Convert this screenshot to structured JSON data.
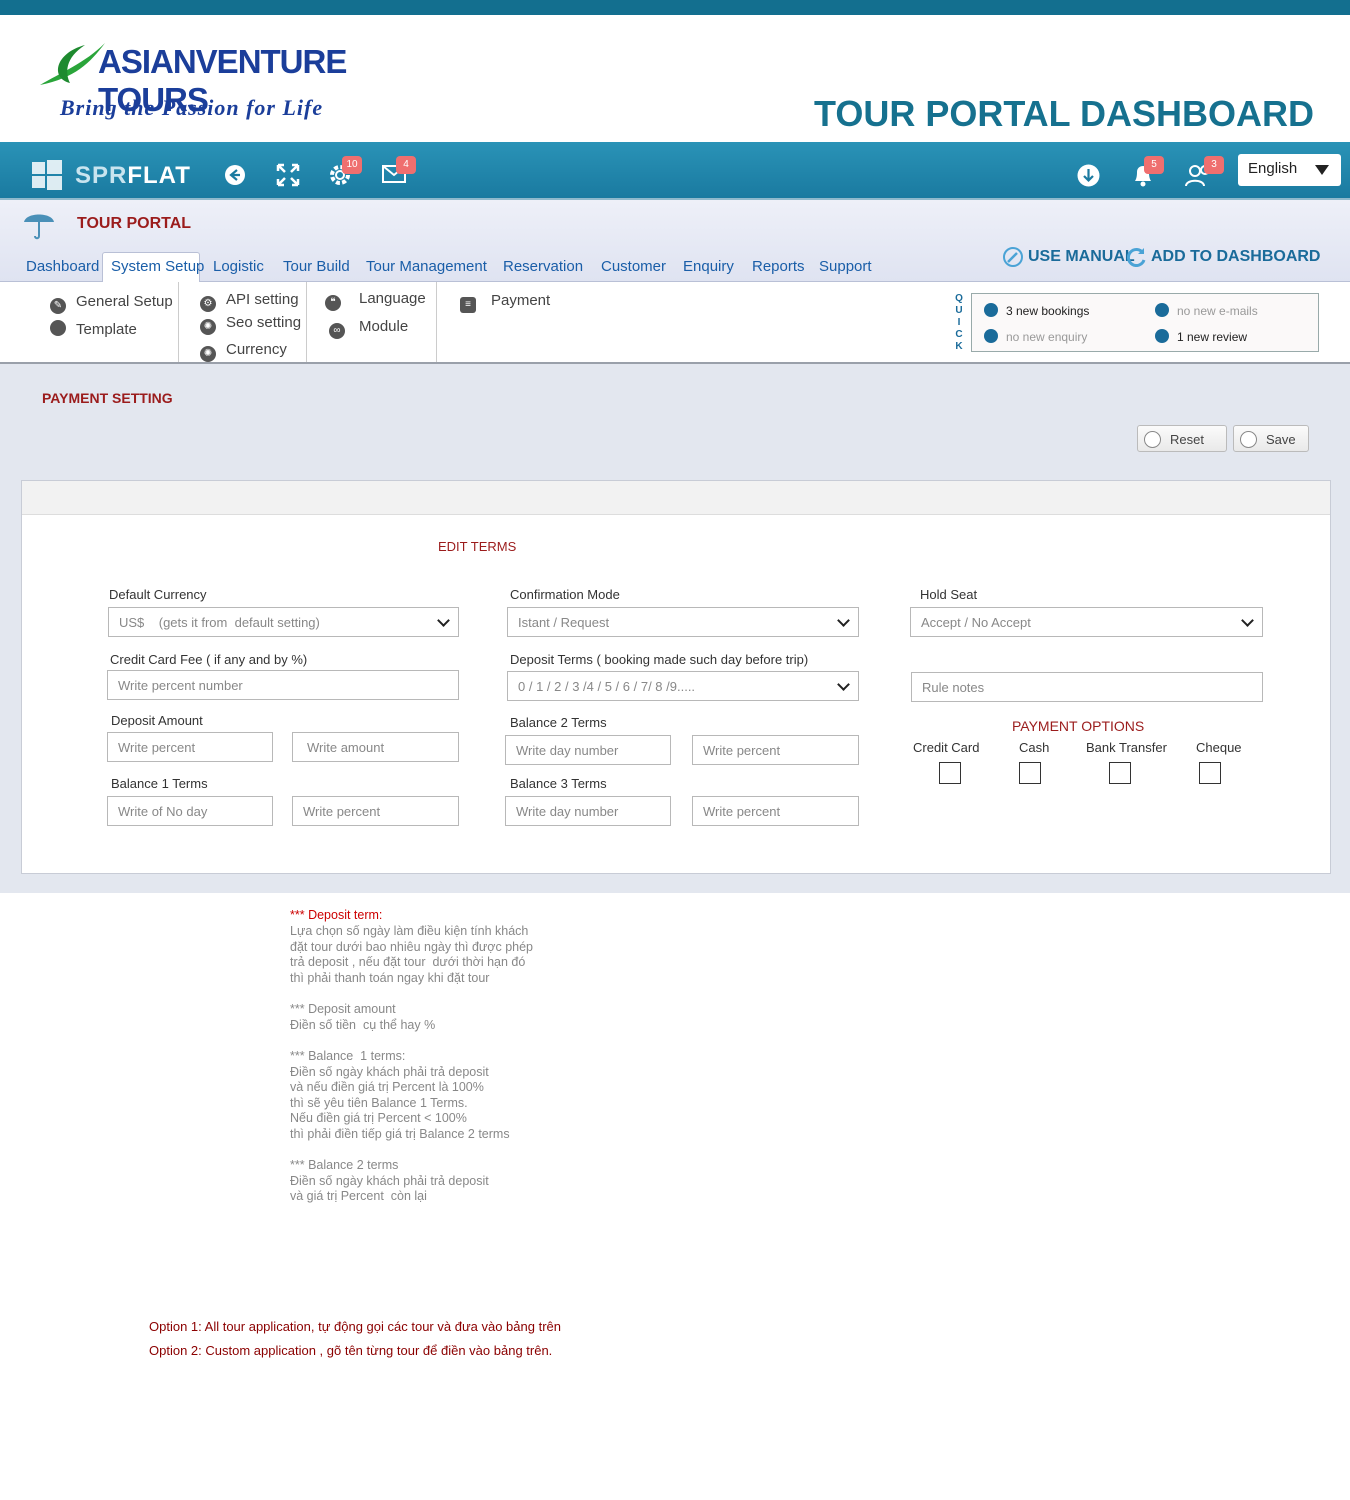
{
  "header": {
    "logo_text": "ASIANVENTURE TOURS",
    "tagline": "Bring the Passion for Life",
    "dashboard_title": "TOUR PORTAL DASHBOARD"
  },
  "navbar": {
    "brand_dim": "SPR",
    "brand_bright": "FLAT",
    "settings_badge": "10",
    "mail_badge": "4",
    "notif_badge": "5",
    "users_badge": "3",
    "language": "English"
  },
  "portal": {
    "title": "TOUR PORTAL",
    "tabs": [
      "Dashboard",
      "System Setup",
      "Logistic",
      "Tour Build",
      "Tour Management",
      "Reservation",
      "Customer",
      "Enquiry",
      "Reports",
      "Support"
    ],
    "use_manual": "USE MANUAL",
    "add_dashboard": "ADD TO  DASHBOARD"
  },
  "submenu": {
    "general_setup": "General Setup",
    "template": "Template",
    "api_setting": "API setting",
    "seo_setting": "Seo setting",
    "currency": "Currency",
    "language": "Language",
    "module": "Module",
    "payment": "Payment"
  },
  "quick": {
    "label": [
      "Q",
      "U",
      "I",
      "C",
      "K"
    ],
    "new_bookings": "3 new bookings",
    "new_emails": "no new e-mails",
    "new_enquiry": "no new enquiry",
    "new_review": "1 new review"
  },
  "payment": {
    "title": "PAYMENT SETTING",
    "reset": "Reset",
    "save": "Save",
    "edit_terms": "EDIT TERMS",
    "default_currency_label": "Default Currency",
    "default_currency_value": "US$    (gets it from  default setting)",
    "confirmation_label": "Confirmation Mode",
    "confirmation_value": "Istant / Request",
    "hold_seat_label": "Hold Seat",
    "hold_seat_value": "Accept / No Accept",
    "cc_fee_label": "Credit Card Fee ( if any and by %)",
    "cc_fee_placeholder": "Write percent number",
    "deposit_terms_label": "Deposit Terms ( booking made such day before trip)",
    "deposit_terms_value": "0 / 1 / 2 / 3 /4 / 5 / 6 / 7/ 8 /9.....",
    "rule_notes_placeholder": "Rule notes",
    "deposit_amount_label": "Deposit  Amount",
    "deposit_percent_placeholder": "Write  percent",
    "deposit_amount_placeholder": "Write amount",
    "balance2_label": "Balance 2 Terms",
    "balance2_day_placeholder": "Write  day number",
    "balance2_percent_placeholder": "Write percent",
    "payment_options_title": "PAYMENT OPTIONS",
    "options": [
      "Credit Card",
      "Cash",
      "Bank Transfer",
      "Cheque"
    ],
    "balance1_label": "Balance 1 Terms",
    "balance1_day_placeholder": "Write  of No day",
    "balance1_percent_placeholder": "Write percent",
    "balance3_label": "Balance 3 Terms",
    "balance3_day_placeholder": "Write  day number",
    "balance3_percent_placeholder": "Write percent"
  },
  "notes": {
    "deposit_term_title": "*** Deposit term:",
    "deposit_term_body": "Lựa chọn số ngày làm điều kiện tính khách\nđặt tour dưới bao nhiêu ngày thì được phép\ntrả deposit , nếu đặt tour  dưới thời hạn đó\nthì phải thanh toán ngay khi đặt tour",
    "deposit_amount": "*** Deposit amount\nĐiền số tiền  cụ thể hay %",
    "balance1": "*** Balance  1 terms:\nĐiền số ngày khách phải trả deposit\nvà nếu điền giá trị Percent là 100%\nthì sẽ yêu tiên Balance 1 Terms.\nNếu điền giá trị Percent < 100%\nthì phải điền tiếp giá trị Balance 2 terms",
    "balance2": "*** Balance 2 terms\nĐiền số ngày khách phải trả deposit\nvà giá trị Percent  còn lại",
    "option1": "Option 1: All tour application, tự động gọi các tour và đưa vào bảng trên",
    "option2": "Option 2: Custom application , gõ tên từng tour để điền vào bảng trên."
  },
  "colors": {
    "navbar": "#1a7aa0",
    "title_teal": "#16718f",
    "accent_red": "#9b1c1c",
    "badge": "#ef6f6f"
  }
}
